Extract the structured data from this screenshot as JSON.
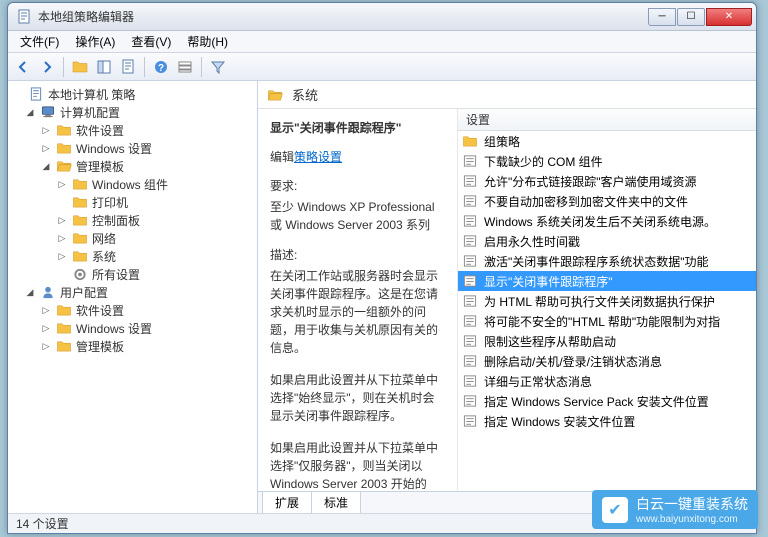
{
  "window": {
    "title": "本地组策略编辑器"
  },
  "menu": {
    "file": "文件(F)",
    "action": "操作(A)",
    "view": "查看(V)",
    "help": "帮助(H)"
  },
  "tree": {
    "root": "本地计算机 策略",
    "computer": "计算机配置",
    "software": "软件设置",
    "windows_settings": "Windows 设置",
    "admin_templates": "管理模板",
    "windows_components": "Windows 组件",
    "printers": "打印机",
    "control_panel": "控制面板",
    "network": "网络",
    "system": "系统",
    "all_settings": "所有设置",
    "user": "用户配置",
    "user_software": "软件设置",
    "user_windows": "Windows 设置",
    "user_admin": "管理模板"
  },
  "right_header": {
    "title": "系统"
  },
  "desc": {
    "title": "显示\"关闭事件跟踪程序\"",
    "edit_label": "编辑",
    "edit_link": "策略设置",
    "req_label": "要求:",
    "req_text": "至少 Windows XP Professional 或 Windows Server 2003 系列",
    "desc_label": "描述:",
    "desc_p1": "在关闭工作站或服务器时会显示关闭事件跟踪程序。这是在您请求关机时显示的一组额外的问题，用于收集与关机原因有关的信息。",
    "desc_p2": "如果启用此设置并从下拉菜单中选择\"始终显示\"，则在关机时会显示关闭事件跟踪程序。",
    "desc_p3": "如果启用此设置并从下拉菜单中选择\"仅服务器\"，则当关闭以 Windows Server 2003 开始的"
  },
  "list": {
    "header": "设置",
    "items": [
      {
        "type": "folder",
        "label": "组策略"
      },
      {
        "type": "setting",
        "label": "下载缺少的 COM 组件"
      },
      {
        "type": "setting",
        "label": "允许\"分布式链接跟踪\"客户端使用域资源"
      },
      {
        "type": "setting",
        "label": "不要自动加密移到加密文件夹中的文件"
      },
      {
        "type": "setting",
        "label": "Windows 系统关闭发生后不关闭系统电源。"
      },
      {
        "type": "setting",
        "label": "启用永久性时间戳"
      },
      {
        "type": "setting",
        "label": "激活\"关闭事件跟踪程序系统状态数据\"功能"
      },
      {
        "type": "setting",
        "label": "显示\"关闭事件跟踪程序\"",
        "selected": true
      },
      {
        "type": "setting",
        "label": "为 HTML 帮助可执行文件关闭数据执行保护"
      },
      {
        "type": "setting",
        "label": "将可能不安全的\"HTML 帮助\"功能限制为对指"
      },
      {
        "type": "setting",
        "label": "限制这些程序从帮助启动"
      },
      {
        "type": "setting",
        "label": "删除启动/关机/登录/注销状态消息"
      },
      {
        "type": "setting",
        "label": "详细与正常状态消息"
      },
      {
        "type": "setting",
        "label": "指定 Windows Service Pack 安装文件位置"
      },
      {
        "type": "setting",
        "label": "指定 Windows 安装文件位置"
      }
    ]
  },
  "tabs": {
    "extended": "扩展",
    "standard": "标准"
  },
  "status": {
    "text": "14 个设置"
  },
  "watermark": {
    "title": "白云一键重装系统",
    "url": "www.baiyunxitong.com"
  }
}
